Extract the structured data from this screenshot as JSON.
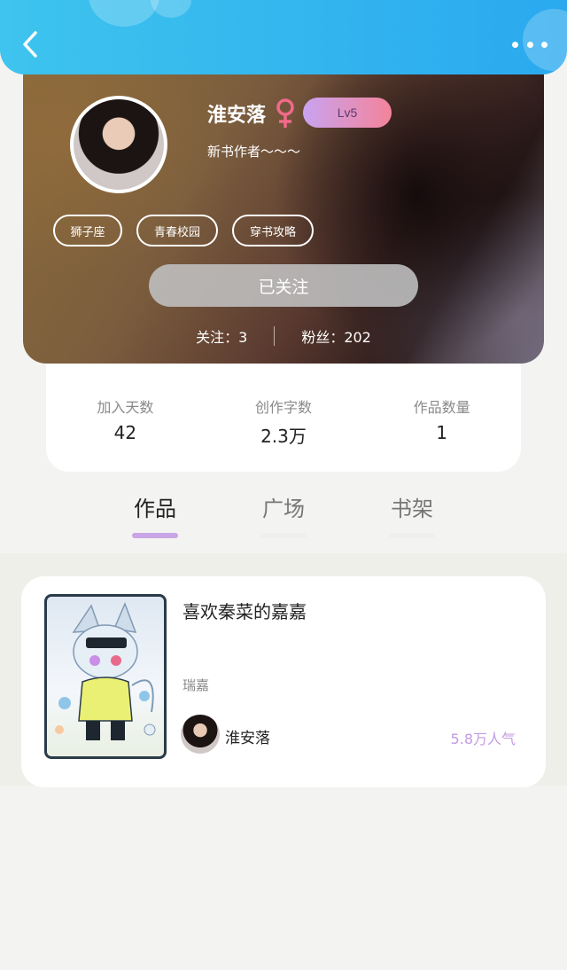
{
  "header": {
    "back_icon": "chevron-left-icon",
    "more_icon": "more-dots-icon",
    "bar_color": "#2aa9ef"
  },
  "profile": {
    "name": "淮安落",
    "gender_icon": "female-icon",
    "level": "Lv5",
    "signature": "新书作者～～～",
    "tags": [
      "狮子座",
      "青春校园",
      "穿书攻略"
    ],
    "follow_button": "已关注",
    "following_label": "关注：3",
    "fans_label": "粉丝：202"
  },
  "stats": [
    {
      "label": "加入天数",
      "value": "42"
    },
    {
      "label": "创作字数",
      "value": "2.3万"
    },
    {
      "label": "作品数量",
      "value": "1"
    }
  ],
  "tabs": [
    {
      "label": "作品",
      "active": true
    },
    {
      "label": "广场",
      "active": false
    },
    {
      "label": "书架",
      "active": false
    }
  ],
  "works": [
    {
      "title": "喜欢秦菜的嘉嘉",
      "tag": "瑞嘉",
      "author": "淮安落",
      "popularity": "5.8万人气"
    }
  ],
  "colors": {
    "accent_purple": "#c49be3",
    "level_gradient_start": "#c9a3f0",
    "level_gradient_end": "#f3839a",
    "female_icon": "#f06a8a"
  }
}
